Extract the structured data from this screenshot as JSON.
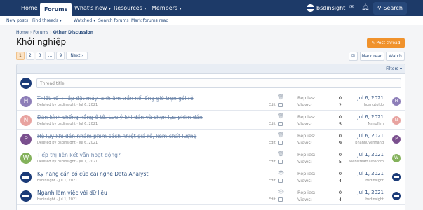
{
  "nav": {
    "home": "Home",
    "forums": "Forums",
    "whats_new": "What's new",
    "resources": "Resources",
    "members": "Members",
    "username": "bsdinsight",
    "search": "Search",
    "caret": "▾"
  },
  "subnav": [
    "New posts",
    "Find threads",
    "Watched",
    "Search forums",
    "Mark forums read"
  ],
  "breadcrumb": [
    "Home",
    "Forums",
    "Other Discussion"
  ],
  "breadcrumb_sep": "›",
  "page_title": "Khởi nghiệp",
  "post_thread": "Post thread",
  "pagination": {
    "pages": [
      "1",
      "2",
      "3",
      "…",
      "9"
    ],
    "next": "Next ›"
  },
  "tools": {
    "mark_read": "Mark read",
    "watch": "Watch"
  },
  "filters": "Filters",
  "new_thread_placeholder": "Thread title",
  "labels": {
    "replies": "Replies:",
    "views": "Views:",
    "edit": "Edit"
  },
  "colors": {
    "nav": "#1d3a68",
    "accent": "#f0922c",
    "link": "#2d4f7e"
  },
  "threads": [
    {
      "avatar": "H",
      "avatar_color": "#8d7eb8",
      "title": "Thiết kế + lắp đặt máy lạnh âm trần nối ống gió trọn gói rẻ",
      "meta": "Deleted by bsdinsight · Jul 6, 2021",
      "replies": "0",
      "views": "2",
      "last_date": "Jul 6, 2021",
      "last_user": "hoangtoldo",
      "last_avatar": "H",
      "last_avatar_color": "#8d7eb8",
      "deleted": true,
      "icon": "trash-icon"
    },
    {
      "avatar": "N",
      "avatar_color": "#e8a3a0",
      "title": "Dán kính chống nắng ô tô. Lưu ý khi dán và chọn lựa phim dán",
      "meta": "Deleted by bsdinsight · Jul 6, 2021",
      "replies": "0",
      "views": "5",
      "last_date": "Jul 6, 2021",
      "last_user": "Nanofilm",
      "last_avatar": "N",
      "last_avatar_color": "#e8a3a0",
      "deleted": true,
      "icon": "trash-icon"
    },
    {
      "avatar": "P",
      "avatar_color": "#7a4f8e",
      "title": "Hệ lụy khi dán nhầm phim cách nhiệt giá rẻ, kém chất lượng",
      "meta": "Deleted by bsdinsight · Jul 6, 2021",
      "replies": "0",
      "views": "9",
      "last_date": "Jul 6, 2021",
      "last_user": "phanhuyenhang",
      "last_avatar": "P",
      "last_avatar_color": "#7a4f8e",
      "deleted": true,
      "icon": "trash-icon"
    },
    {
      "avatar": "W",
      "avatar_color": "#84b25c",
      "title": "Tiếp thị liên kết vẫn hoạt động?",
      "meta": "Deleted by bsdinsight · Jul 1, 2021",
      "replies": "0",
      "views": "5",
      "last_date": "Jul 1, 2021",
      "last_user": "websiteaffiliatecom",
      "last_avatar": "W",
      "last_avatar_color": "#84b25c",
      "deleted": true,
      "icon": "trash-icon"
    },
    {
      "avatar": "",
      "avatar_color": "#1b3b78",
      "title": "Kỹ năng cần có của cái nghề Data Analyst",
      "meta": "bsdinsight · Jul 1, 2021",
      "replies": "0",
      "views": "4",
      "last_date": "Jul 1, 2021",
      "last_user": "bsdinsight",
      "last_avatar": "",
      "last_avatar_color": "#1b3b78",
      "deleted": false,
      "icon": "eye-icon"
    },
    {
      "avatar": "",
      "avatar_color": "#1b3b78",
      "title": "Ngành làm việc với dữ liệu",
      "meta": "bsdinsight · Jul 1, 2021",
      "replies": "0",
      "views": "4",
      "last_date": "Jul 1, 2021",
      "last_user": "bsdinsight",
      "last_avatar": "",
      "last_avatar_color": "#1b3b78",
      "deleted": false,
      "icon": "eye-icon"
    }
  ]
}
